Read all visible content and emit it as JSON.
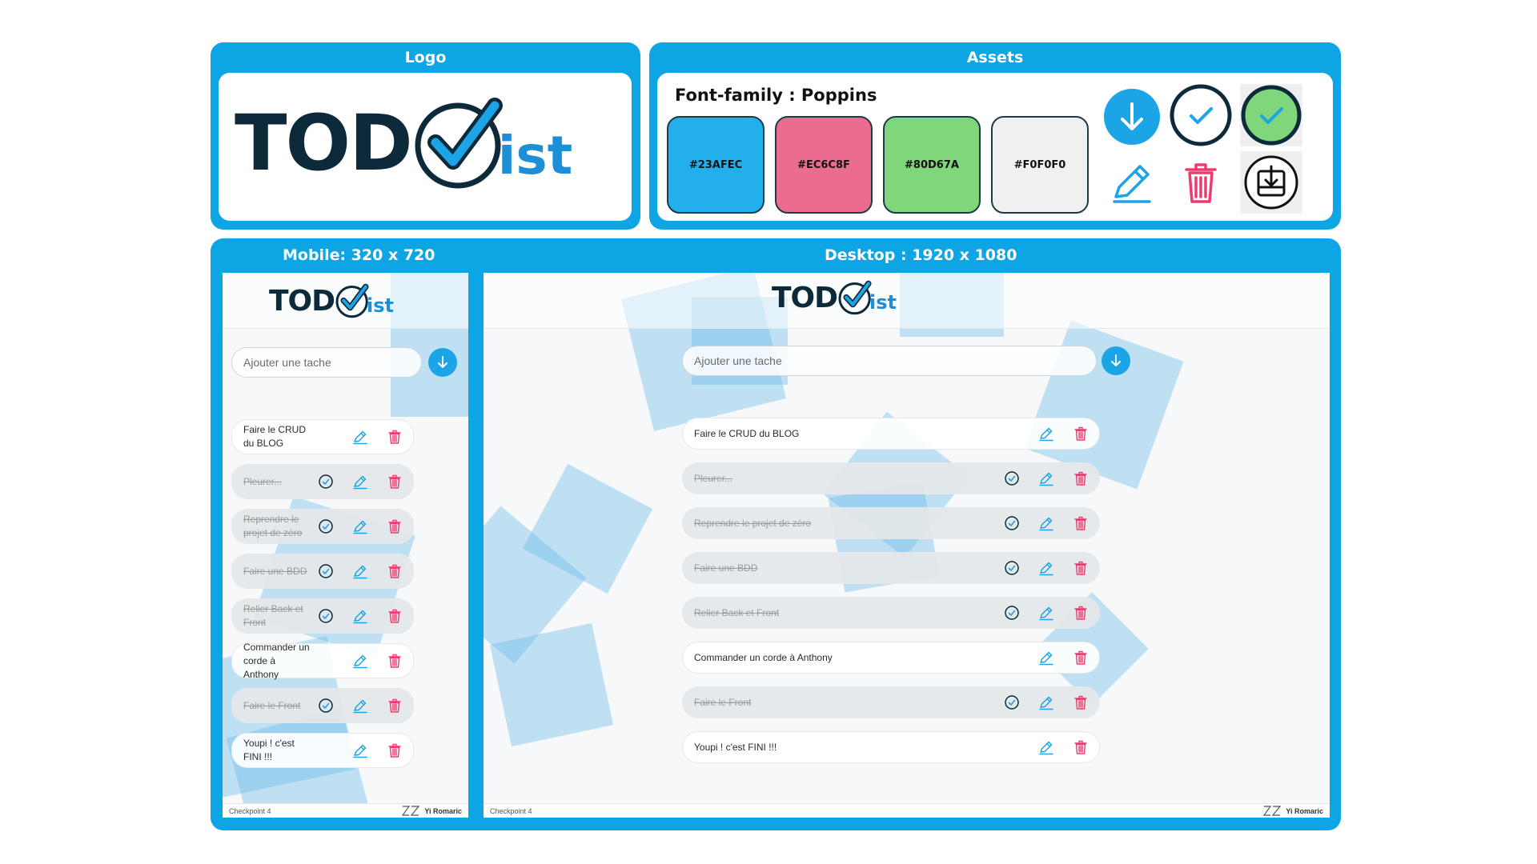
{
  "logo_panel": {
    "title": "Logo",
    "logo_prefix": "TOD",
    "logo_suffix": "ist"
  },
  "assets_panel": {
    "title": "Assets",
    "font_label": "Font-family :  Poppins",
    "swatches": [
      {
        "label": "#23AFEC",
        "color": "#23AFEC"
      },
      {
        "label": "#EC6C8F",
        "color": "#EC6C8F"
      },
      {
        "label": "#80D67A",
        "color": "#80D67A"
      },
      {
        "label": "#F0F0F0",
        "color": "#F0F0F0"
      }
    ],
    "icons": [
      "arrow-down-circle-icon",
      "check-circle-outline-icon",
      "check-circle-green-icon",
      "pencil-icon",
      "trash-icon",
      "download-box-icon"
    ]
  },
  "mobile": {
    "title": "Mobile: 320 x 720",
    "input_placeholder": "Ajouter une tache",
    "tasks": [
      {
        "label": "Faire le CRUD du BLOG",
        "done": false
      },
      {
        "label": "Pleurer...",
        "done": true
      },
      {
        "label": "Reprendre le projet de zéro",
        "done": true
      },
      {
        "label": "Faire une BDD",
        "done": true
      },
      {
        "label": "Relier Back et Front",
        "done": true
      },
      {
        "label": "Commander un corde à Anthony",
        "done": false
      },
      {
        "label": "Faire le Front",
        "done": true
      },
      {
        "label": "Youpi ! c'est FINI !!!",
        "done": false
      }
    ],
    "footer_left": "Checkpoint 4",
    "footer_right": "Yi Romaric"
  },
  "desktop": {
    "title": "Desktop : 1920 x 1080",
    "input_placeholder": "Ajouter une tache",
    "tasks": [
      {
        "label": "Faire le CRUD du BLOG",
        "done": false
      },
      {
        "label": "Pleurer...",
        "done": true
      },
      {
        "label": "Reprendre le projet de zéro",
        "done": true
      },
      {
        "label": "Faire une BDD",
        "done": true
      },
      {
        "label": "Relier Back et Front",
        "done": true
      },
      {
        "label": "Commander un corde à Anthony",
        "done": false
      },
      {
        "label": "Faire le Front",
        "done": true
      },
      {
        "label": "Youpi ! c'est FINI !!!",
        "done": false
      }
    ],
    "footer_left": "Checkpoint 4",
    "footer_right": "Yi Romaric"
  },
  "colors": {
    "primary": "#23AFEC",
    "danger": "#EC6C8F",
    "success": "#80D67A",
    "neutral": "#F0F0F0",
    "panel": "#0EA5E4",
    "dark": "#0C2A3A"
  }
}
